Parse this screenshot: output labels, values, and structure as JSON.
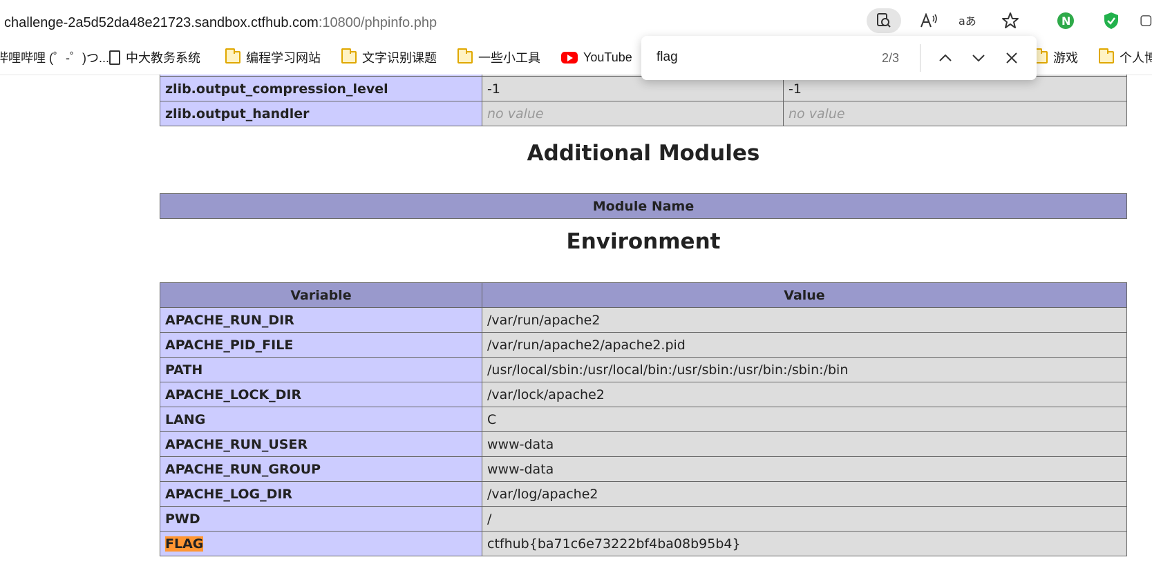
{
  "browser": {
    "address_host": "challenge-2a5d52da48e21723.sandbox.ctfhub.com",
    "address_path": ":10800/phpinfo.php",
    "toolbar_icons": [
      "page-search-icon",
      "read-aloud-icon",
      "translate-icon",
      "favorite-star-icon",
      "extension-n-icon",
      "extension-shield-icon"
    ]
  },
  "bookmarks": [
    {
      "label": "哔哩哔哩 (゜-゜)つ...",
      "icon": "none"
    },
    {
      "label": "中大教务系统",
      "icon": "page"
    },
    {
      "label": "编程学习网站",
      "icon": "folder"
    },
    {
      "label": "文字识别课题",
      "icon": "folder"
    },
    {
      "label": "一些小工具",
      "icon": "folder"
    },
    {
      "label": "YouTube",
      "icon": "youtube"
    },
    {
      "label": "游戏",
      "icon": "folder"
    },
    {
      "label": "个人博",
      "icon": "folder"
    }
  ],
  "find": {
    "query": "flag",
    "count": "2/3"
  },
  "zlib_rows": [
    {
      "name": "zlib.output_compression_level",
      "local": "-1",
      "master": "-1",
      "novalue": false
    },
    {
      "name": "zlib.output_handler",
      "local": "no value",
      "master": "no value",
      "novalue": true
    }
  ],
  "modules": {
    "title": "Additional Modules",
    "header": "Module Name"
  },
  "environment": {
    "title": "Environment",
    "headers": [
      "Variable",
      "Value"
    ],
    "rows": [
      {
        "name": "APACHE_RUN_DIR",
        "value": "/var/run/apache2"
      },
      {
        "name": "APACHE_PID_FILE",
        "value": "/var/run/apache2/apache2.pid"
      },
      {
        "name": "PATH",
        "value": "/usr/local/sbin:/usr/local/bin:/usr/sbin:/usr/bin:/sbin:/bin"
      },
      {
        "name": "APACHE_LOCK_DIR",
        "value": "/var/lock/apache2"
      },
      {
        "name": "LANG",
        "value": "C"
      },
      {
        "name": "APACHE_RUN_USER",
        "value": "www-data"
      },
      {
        "name": "APACHE_RUN_GROUP",
        "value": "www-data"
      },
      {
        "name": "APACHE_LOG_DIR",
        "value": "/var/log/apache2"
      },
      {
        "name": "PWD",
        "value": "/"
      },
      {
        "name": "FLAG",
        "value": "ctfhub{ba71c6e73222bf4ba08b95b4}"
      }
    ]
  },
  "colors": {
    "label_cell": "#ccccff",
    "value_cell": "#dddddd",
    "header_cell": "#9999cc",
    "find_highlight": "#ff9632"
  }
}
